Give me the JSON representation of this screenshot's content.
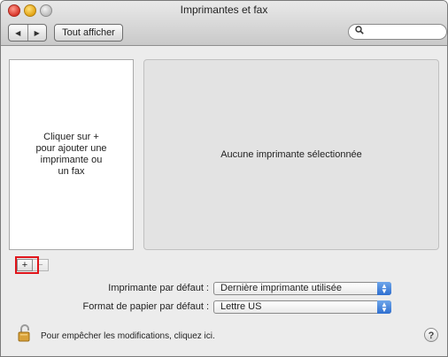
{
  "window": {
    "title": "Imprimantes et fax"
  },
  "toolbar": {
    "back_icon": "triangle-left",
    "forward_icon": "triangle-right",
    "show_all_label": "Tout afficher",
    "search_icon": "magnifier",
    "search_value": ""
  },
  "printer_list": {
    "empty_hint": "Cliquer sur +\npour ajouter une\nimprimante ou\nun fax"
  },
  "detail": {
    "no_selection": "Aucune imprimante sélectionnée"
  },
  "list_controls": {
    "add_label": "+",
    "remove_label": "−"
  },
  "settings": {
    "default_printer_label": "Imprimante par défaut :",
    "default_printer_value": "Dernière imprimante utilisée",
    "paper_size_label": "Format de papier par défaut :",
    "paper_size_value": "Lettre US"
  },
  "footer": {
    "lock_text": "Pour empêcher les modifications, cliquez ici.",
    "help_label": "?"
  },
  "colors": {
    "highlight": "#e0151b",
    "popup_accent": "#3b7be0"
  }
}
